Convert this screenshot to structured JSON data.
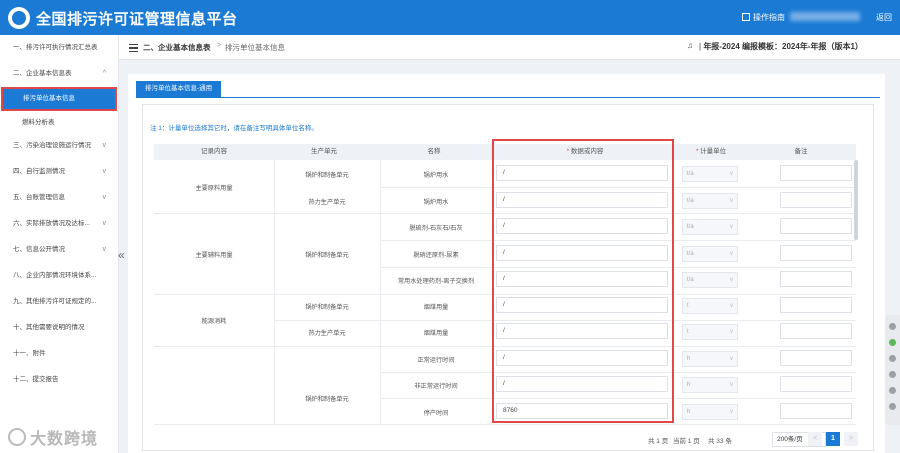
{
  "app": {
    "title": "全国排污许可证管理信息平台",
    "guide": "操作指南",
    "back": "返回"
  },
  "sidebar": {
    "items": [
      {
        "label": "一、排污许可执行情况汇总表",
        "chev": ""
      },
      {
        "label": "二、企业基本信息表",
        "chev": "^"
      },
      {
        "label": "排污单位基本信息",
        "sub": true,
        "active": true
      },
      {
        "label": "燃料分析表",
        "sub": true
      },
      {
        "label": "三、污染治理设施运行情况",
        "chev": "v"
      },
      {
        "label": "四、自行监测情况",
        "chev": "v"
      },
      {
        "label": "五、台账管理信息",
        "chev": "v"
      },
      {
        "label": "六、实际排放情况及达标...",
        "chev": "v"
      },
      {
        "label": "七、信息公开情况",
        "chev": "v"
      },
      {
        "label": "八、企业内部情况环境体系...",
        "chev": ""
      },
      {
        "label": "九、其他排污许可证规定的...",
        "chev": ""
      },
      {
        "label": "十、其他需要说明的情况",
        "chev": ""
      },
      {
        "label": "十一、附件",
        "chev": ""
      },
      {
        "label": "十二、提交报告",
        "chev": ""
      }
    ],
    "collapse_icon": "double-chevron-left-icon"
  },
  "watermark": "大数跨境",
  "header": {
    "breadcrumb_1": "二、企业基本信息表",
    "breadcrumb_sep": ">",
    "breadcrumb_2": "排污单位基本信息",
    "report_prefix": "年报-2024",
    "template_label": "编报模板：",
    "template_value": "2024年-年报（版本1）"
  },
  "tab": {
    "label": "排污单位基本信息-通用"
  },
  "note": "注 1：计量单位选择其它时，请在备注写明具体单位名称。",
  "table": {
    "headers": {
      "c1": "记录内容",
      "c2": "生产单元",
      "c3": "名称",
      "c4_req": "*",
      "c4": "数据或内容",
      "c5_req": "*",
      "c5": "计量单位",
      "c6": "备注"
    },
    "groups": {
      "g1": "主要原料用量",
      "g2": "主要辅料用量",
      "g3": "能源消耗"
    },
    "units": {
      "u1": "锅炉和制备单元",
      "u2": "热力生产单元",
      "u3": "锅炉和制备单元",
      "u4": "锅炉和制备单元",
      "u5": "热力生产单元",
      "u6": "锅炉和制备单元"
    },
    "rows": [
      {
        "name": "锅炉用水",
        "value": "/",
        "unit": "t/a"
      },
      {
        "name": "锅炉用水",
        "value": "/",
        "unit": "t/a"
      },
      {
        "name": "脱硫剂-石灰石/石灰",
        "value": "/",
        "unit": "t/a"
      },
      {
        "name": "脱硝还原剂-尿素",
        "value": "/",
        "unit": "t/a"
      },
      {
        "name": "常用水处理药剂-离子交换剂",
        "value": "/",
        "unit": "t/a"
      },
      {
        "name": "烟煤用量",
        "value": "/",
        "unit": "t"
      },
      {
        "name": "烟煤用量",
        "value": "/",
        "unit": "t"
      },
      {
        "name": "正常运行时间",
        "value": "/",
        "unit": "h"
      },
      {
        "name": "非正常运行时间",
        "value": "/",
        "unit": "h"
      },
      {
        "name": "停产时间",
        "value": "8760",
        "unit": "h"
      }
    ]
  },
  "pager": {
    "total_pages": "共 1 页",
    "current": "当前 1 页",
    "total_items": "共 33 条",
    "page_size": "200条/页",
    "prev": "<",
    "page": "1",
    "next": ">"
  }
}
